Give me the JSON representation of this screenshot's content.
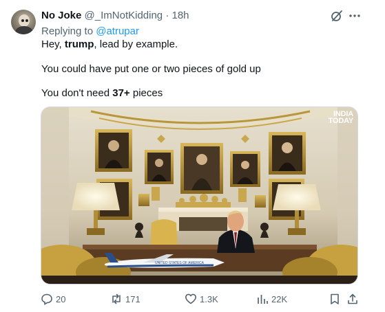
{
  "tweet": {
    "author_name": "No Joke",
    "author_handle": "@_ImNotKidding",
    "separator": "·",
    "time": "18h",
    "reply_prefix": "Replying to",
    "reply_to": "@atrupar",
    "line1_pre": "Hey, ",
    "line1_bold": "trump",
    "line1_post": ", lead by example.",
    "line2": "You could have put one or two pieces of gold up",
    "line3_pre": "You don't need ",
    "line3_bold": "37+",
    "line3_post": " pieces"
  },
  "media": {
    "watermark_line1": "INDIA",
    "watermark_line2": "TODAY",
    "plane_text": "UNITED STATES OF AMERICA"
  },
  "actions": {
    "replies": "20",
    "reposts": "171",
    "likes": "1.3K",
    "views": "22K"
  },
  "icons": [
    "grok-icon",
    "more-icon",
    "reply-icon",
    "repost-icon",
    "like-icon",
    "views-icon",
    "bookmark-icon",
    "share-icon"
  ],
  "colors": {
    "link": "#1d9bf0",
    "secondary": "#536471",
    "text": "#0f1419"
  }
}
